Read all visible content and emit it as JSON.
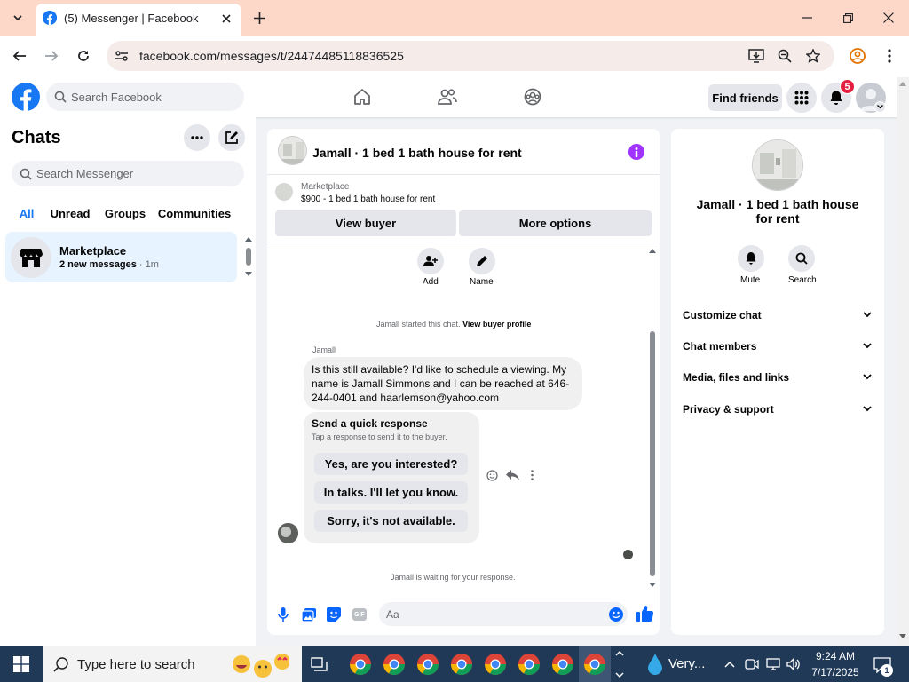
{
  "browser": {
    "tab_title": "(5) Messenger | Facebook",
    "url": "facebook.com/messages/t/24474485118836525"
  },
  "fb_header": {
    "search_placeholder": "Search Facebook",
    "find_friends": "Find friends",
    "notification_count": "5"
  },
  "sidebar": {
    "title": "Chats",
    "search_placeholder": "Search Messenger",
    "filters": [
      "All",
      "Unread",
      "Groups",
      "Communities"
    ],
    "active_filter": "All",
    "chats": [
      {
        "name": "Marketplace",
        "preview": "2 new messages",
        "time": "1m"
      }
    ]
  },
  "conversation": {
    "title": "Jamall · 1 bed 1 bath house for rent",
    "listing_source": "Marketplace",
    "listing_line": "$900 - 1 bed 1 bath house for rent",
    "view_buyer": "View buyer",
    "more_options": "More options",
    "actions": [
      "Add",
      "Name"
    ],
    "system_text": "Jamall started this chat.",
    "system_link": "View buyer profile",
    "sender_name": "Jamall",
    "message": "Is this still available? I'd like to schedule a viewing. My name is Jamall Simmons and I can be reached at 646-244-0401 and haarlemson@yahoo.com",
    "quick_title": "Send a quick response",
    "quick_sub": "Tap a response to send it to the buyer.",
    "quick_responses": [
      "Yes, are you interested?",
      "In talks. I'll let you know.",
      "Sorry, it's not available."
    ],
    "waiting_text": "Jamall is waiting for your response.",
    "composer_placeholder": "Aa",
    "gif_label": "GIF"
  },
  "details": {
    "title": "Jamall · 1 bed 1 bath house for rent",
    "actions": [
      "Mute",
      "Search"
    ],
    "sections": [
      "Customize chat",
      "Chat members",
      "Media, files and links",
      "Privacy & support"
    ]
  },
  "taskbar": {
    "search_placeholder": "Type here to search",
    "weather": "Very...",
    "time": "9:24 AM",
    "date": "7/17/2025",
    "notif_count": "1"
  },
  "colors": {
    "fb_blue": "#1877f2",
    "messenger_purple": "#a033ff",
    "selected_chat_bg": "#e7f3ff",
    "tabbar_bg": "#fdd8c8",
    "taskbar_bg": "#1f3957",
    "badge_red": "#e41e3f"
  },
  "icons": [
    "chevron-down-icon",
    "facebook-icon",
    "close-icon",
    "plus-icon",
    "minimize-icon",
    "maximize-icon",
    "back-icon",
    "forward-icon",
    "reload-icon",
    "site-info-icon",
    "install-icon",
    "zoom-icon",
    "star-icon",
    "profile-icon",
    "kebab-icon",
    "search-icon",
    "home-icon",
    "friends-icon",
    "groups-icon",
    "apps-grid-icon",
    "bell-icon",
    "avatar",
    "more-icon",
    "compose-icon",
    "marketplace-store-icon",
    "info-icon",
    "add-person-icon",
    "pencil-icon",
    "emoji-icon",
    "reply-icon",
    "mic-icon",
    "photo-icon",
    "sticker-icon",
    "gif-icon",
    "like-icon",
    "mute-icon",
    "windows-icon",
    "task-view-icon",
    "chrome-icon",
    "weather-icon",
    "notification-icon"
  ]
}
